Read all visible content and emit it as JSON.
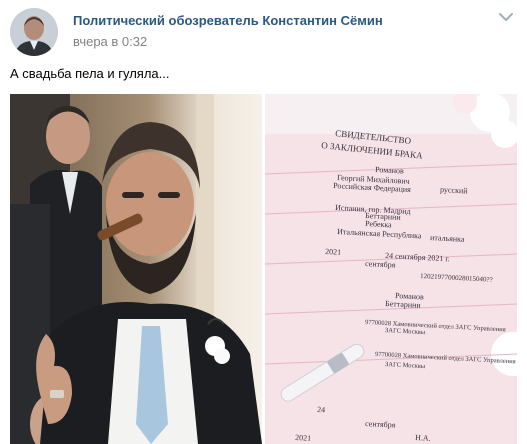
{
  "post": {
    "author": "Политический обозреватель Константин Сёмин",
    "time": "вчера в 0:32",
    "text": "А свадьба пела и гуляла...",
    "more_icon": "more-icon"
  },
  "certificate": {
    "title_line1": "СВИДЕТЕЛЬСТВО",
    "title_line2": "О ЗАКЛЮЧЕНИИ БРАКА",
    "groom_surname": "Романов",
    "groom_name": "Георгий Михайлович",
    "groom_country": "Российская Федерация",
    "groom_nationality": "русский",
    "groom_birthplace": "Испания, гор. Мадрид",
    "bride_surname": "Беттарини",
    "bride_name": "Ребекка",
    "bride_country": "Итальянская Республика",
    "bride_nationality": "итальянка",
    "marriage_year": "2021",
    "marriage_date": "24 сентября 2021 г.",
    "marriage_month": "сентября",
    "record_no": "1202197700028015040??",
    "surname_after_1": "Романов",
    "surname_after_2": "Беттарини",
    "registry_1": "97700028 Хамовнический отдел ЗАГС Управления",
    "registry_1b": "ЗАГС Москвы",
    "registry_2": "97700028 Хамовнический отдел ЗАГС Управления",
    "registry_2b": "ЗАГС Москвы",
    "issue_day": "24",
    "issue_month": "сентября",
    "issue_year": "2021",
    "signature": "Н.А."
  },
  "colors": {
    "link": "#2a5885",
    "muted": "#828282"
  }
}
